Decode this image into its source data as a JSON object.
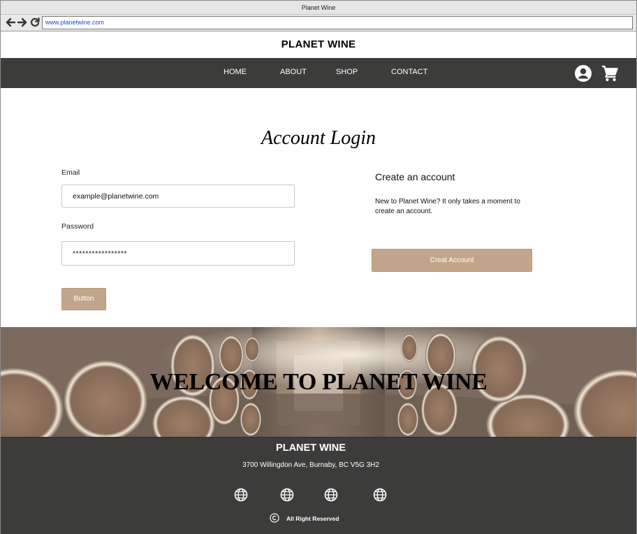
{
  "browser": {
    "window_title": "Planet Wine",
    "url": "www.planetwine.com",
    "icons": [
      "back-arrow-icon",
      "forward-arrow-icon",
      "reload-icon"
    ]
  },
  "header": {
    "brand": "PLANET WINE",
    "nav": [
      "HOME",
      "ABOUT",
      "SHOP",
      "CONTACT"
    ],
    "icons": [
      "account-icon",
      "cart-icon"
    ],
    "nav_bg": "#3c3c3b"
  },
  "login": {
    "title": "Account Login",
    "email_label": "Email",
    "email_value": "example@planetwine.com",
    "password_label": "Password",
    "password_value": "*****************",
    "submit_label": "Button",
    "accent": "#c2a68b"
  },
  "create": {
    "heading": "Create an account",
    "text": "New to Planet Wine? It only takes a moment to create an account.",
    "button_label": "Creat Account"
  },
  "hero": {
    "text": "WELCOME TO PLANET WINE"
  },
  "footer": {
    "brand": "PLANET WINE",
    "address": "3700 Willingdon Ave, Burnaby, BC V5G 3H2",
    "social_icons": [
      "globe-icon",
      "globe-icon",
      "globe-icon",
      "globe-icon"
    ],
    "copyright_icon": "copyright-icon",
    "copyright": "All Right Reserved"
  }
}
